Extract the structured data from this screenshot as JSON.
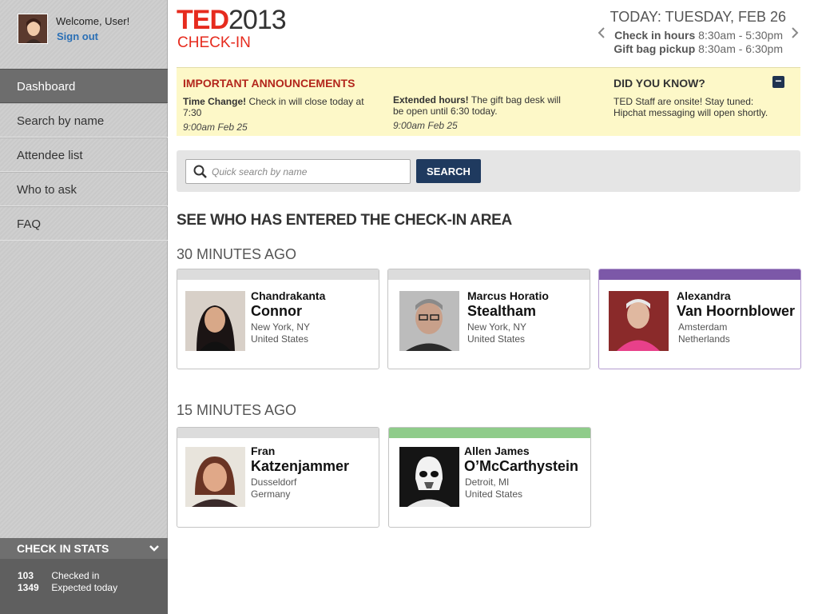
{
  "user": {
    "welcome": "Welcome, User!",
    "sign_out": "Sign out"
  },
  "nav": {
    "items": [
      {
        "label": "Dashboard",
        "active": true
      },
      {
        "label": "Search by name"
      },
      {
        "label": "Attendee list"
      },
      {
        "label": "Who to ask"
      },
      {
        "label": "FAQ"
      }
    ]
  },
  "stats": {
    "title": "CHECK IN STATS",
    "checked_in_count": "103",
    "checked_in_label": "Checked in",
    "expected_count": "1349",
    "expected_label": "Expected today"
  },
  "header": {
    "logo_ted": "TED",
    "logo_year": "2013",
    "logo_sub": "CHECK-IN",
    "today": "TODAY: TUESDAY, FEB 26",
    "checkin_label": "Check in hours",
    "checkin_time": "8:30am - 5:30pm",
    "giftbag_label": "Gift bag pickup",
    "giftbag_time": "8:30am - 6:30pm"
  },
  "announcements": {
    "title": "IMPORTANT ANNOUNCEMENTS",
    "item1_bold": "Time Change!",
    "item1_text": " Check in will close today at 7:30",
    "item1_date": "9:00am Feb 25",
    "item2_bold": "Extended hours!",
    "item2_text": " The gift bag desk will be open until 6:30 today.",
    "item2_date": "9:00am Feb 25",
    "dyk_title": "DID YOU KNOW?",
    "dyk_text": "TED Staff are onsite! Stay tuned: Hipchat messaging will open shortly.",
    "collapse_glyph": "−"
  },
  "search": {
    "placeholder": "Quick search by name",
    "button": "SEARCH"
  },
  "section_heading": "SEE WHO HAS ENTERED THE CHECK-IN AREA",
  "groups": {
    "g30": "30 MINUTES AGO",
    "g15": "15 MINUTES AGO"
  },
  "cards": [
    {
      "first": "Chandrakanta",
      "last": "Connor",
      "city": "New York, NY",
      "country": "United States",
      "band_color": "#dcdcdc"
    },
    {
      "first": "Marcus Horatio",
      "last": "Stealtham",
      "city": "New York, NY",
      "country": "United States",
      "band_color": "#dcdcdc"
    },
    {
      "first": "Alexandra",
      "last": "Van Hoornblower",
      "city": "Amsterdam",
      "country": "Netherlands",
      "band_color": "#7c58a8"
    },
    {
      "first": "Fran",
      "last": "Katzenjammer",
      "city": "Dusseldorf",
      "country": "Germany",
      "band_color": "#dcdcdc"
    },
    {
      "first": "Allen James",
      "last": "O’McCarthystein",
      "city": "Detroit, MI",
      "country": "United States",
      "band_color": "#8fcc8a"
    }
  ],
  "colors": {
    "brand_red": "#e62b1e",
    "nav_active": "#6d6d6d",
    "announce_bg": "#fdf8c8",
    "search_button": "#1f3a5f"
  }
}
